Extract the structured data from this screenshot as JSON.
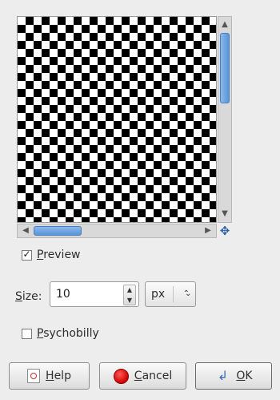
{
  "preview": {
    "pattern": "checkerboard",
    "colors": [
      "#000000",
      "#ffffff"
    ],
    "vscroll_up_icon": "▲",
    "vscroll_down_icon": "▼",
    "hscroll_left_icon": "◀",
    "hscroll_right_icon": "▶",
    "navigate_icon": "✥"
  },
  "preview_toggle": {
    "checked": true,
    "check_glyph": "☑",
    "label_mnemonic": "P",
    "label_rest": "review"
  },
  "size": {
    "label_mnemonic": "S",
    "label_rest": "ize:",
    "value": "10",
    "step_up_icon": "▲",
    "step_down_icon": "▼",
    "unit": "px",
    "unit_chevron": "⌃⌄"
  },
  "psychobilly": {
    "checked": false,
    "label_mnemonic": "P",
    "label_rest": "sychobilly"
  },
  "buttons": {
    "help": {
      "mnemonic": "H",
      "rest": "elp",
      "icon": "help-icon"
    },
    "cancel": {
      "mnemonic": "C",
      "rest": "ancel",
      "icon": "cancel-icon",
      "color": "#d00000"
    },
    "ok": {
      "mnemonic": "O",
      "rest": "K",
      "icon_glyph": "↲",
      "icon": "ok-icon"
    }
  }
}
